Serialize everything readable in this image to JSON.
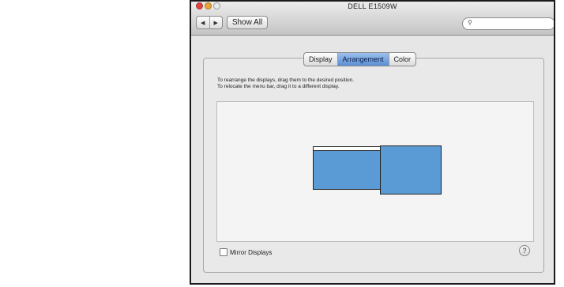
{
  "window": {
    "title": "DELL E1509W"
  },
  "toolbar": {
    "back_icon": "◀",
    "forward_icon": "▶",
    "show_all_label": "Show All",
    "search_value": "",
    "search_icon": "🔍"
  },
  "tabs": [
    {
      "label": "Display",
      "active": false
    },
    {
      "label": "Arrangement",
      "active": true
    },
    {
      "label": "Color",
      "active": false
    }
  ],
  "instructions": {
    "line1": "To rearrange the displays, drag them to the desired position.",
    "line2": "To relocate the menu bar, drag it to a different display."
  },
  "mirror": {
    "label": "Mirror Displays",
    "checked": false
  },
  "help": {
    "label": "?"
  },
  "colors": {
    "display_fill": "#5b9bd5",
    "active_tab": "#5b8fd4"
  }
}
